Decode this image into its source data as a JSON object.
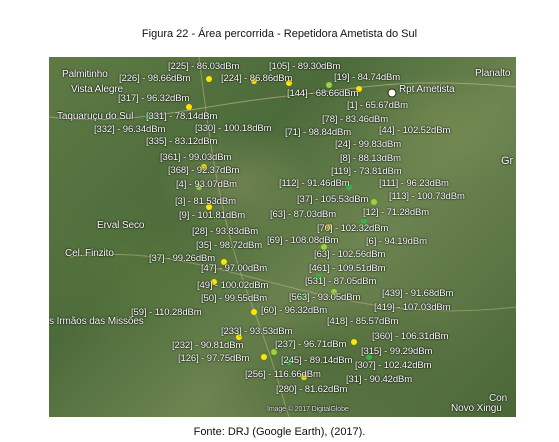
{
  "figure": {
    "title": "Figura 22 - Área percorrida - Repetidora Ametista do Sul",
    "source": "Fonte: DRJ (Google Earth), (2017)."
  },
  "map": {
    "cities": [
      {
        "name": "Palmitinho"
      },
      {
        "name": "Vista Alegre"
      },
      {
        "name": "Taquaruçu do Sul"
      },
      {
        "name": "Erval Seco"
      },
      {
        "name": "Cel. Finzito"
      },
      {
        "name": "s Irmãos das Missões"
      },
      {
        "name": "Planalto"
      },
      {
        "name": "Rpt Ametista"
      },
      {
        "name": "Novo Xingu"
      },
      {
        "name": "Gr"
      },
      {
        "name": "Con"
      }
    ],
    "readings": [
      {
        "label": "[225] - 86.03dBm"
      },
      {
        "label": "[105] - 89.30dBm"
      },
      {
        "label": "[226] - 98.66dBm"
      },
      {
        "label": "[224] - 86.86dBm"
      },
      {
        "label": "[19] - 84.74dBm"
      },
      {
        "label": "[317] - 96.32dBm"
      },
      {
        "label": "[144] - 68.66dBm"
      },
      {
        "label": "[1] - 65.67dBm"
      },
      {
        "label": "[331] - 78.14dBm"
      },
      {
        "label": "[78] - 83.46dBm"
      },
      {
        "label": "[332] - 96.34dBm"
      },
      {
        "label": "[330] - 100.18dBm"
      },
      {
        "label": "[71] - 98.84dBm"
      },
      {
        "label": "[44] - 102.52dBm"
      },
      {
        "label": "[335] - 83.12dBm"
      },
      {
        "label": "[24] - 99.83dBm"
      },
      {
        "label": "[361] - 99.03dBm"
      },
      {
        "label": "[8] - 88.13dBm"
      },
      {
        "label": "[368] - 92.37dBm"
      },
      {
        "label": "[119] - 73.81dBm"
      },
      {
        "label": "[4] - 93.07dBm"
      },
      {
        "label": "[112] - 91.46dBm"
      },
      {
        "label": "[111] - 96.23dBm"
      },
      {
        "label": "[3] - 81.53dBm"
      },
      {
        "label": "[37] - 105.53dBm"
      },
      {
        "label": "[113] - 100.73dBm"
      },
      {
        "label": "[9] - 101.81dBm"
      },
      {
        "label": "[63] - 87.03dBm"
      },
      {
        "label": "[12] - 71.28dBm"
      },
      {
        "label": "[28] - 93.83dBm"
      },
      {
        "label": "[70] - 102.32dBm"
      },
      {
        "label": "[35] - 98.72dBm"
      },
      {
        "label": "[69] - 108.08dBm"
      },
      {
        "label": "[6] - 94.19dBm"
      },
      {
        "label": "[37] - 99.26dBm"
      },
      {
        "label": "[63] - 102.56dBm"
      },
      {
        "label": "[47] - 97.00dBm"
      },
      {
        "label": "[461] - 109.51dBm"
      },
      {
        "label": "[49] - 100.02dBm"
      },
      {
        "label": "[531] - 87.05dBm"
      },
      {
        "label": "[50] - 99.55dBm"
      },
      {
        "label": "[563] - 93.05dBm"
      },
      {
        "label": "[439] - 91.68dBm"
      },
      {
        "label": "[59] - 110.28dBm"
      },
      {
        "label": "[60] - 96.32dBm"
      },
      {
        "label": "[419] - 107.03dBm"
      },
      {
        "label": "[418] - 85.57dBm"
      },
      {
        "label": "[233] - 93.53dBm"
      },
      {
        "label": "[360] - 106.31dBm"
      },
      {
        "label": "[232] - 90.81dBm"
      },
      {
        "label": "[237] - 96.71dBm"
      },
      {
        "label": "[315] - 99.29dBm"
      },
      {
        "label": "[126] - 97.75dBm"
      },
      {
        "label": "[245] - 89.14dBm"
      },
      {
        "label": "[307] - 102.42dBm"
      },
      {
        "label": "[256] - 116.66dBm"
      },
      {
        "label": "[31] - 90.42dBm"
      },
      {
        "label": "[280] - 81.62dBm"
      }
    ],
    "attribution": "Image © 2017 DigitalGlobe",
    "colors": {
      "strong": "#ffe600",
      "medium": "#9bd43a",
      "weak": "#36b44a"
    }
  }
}
